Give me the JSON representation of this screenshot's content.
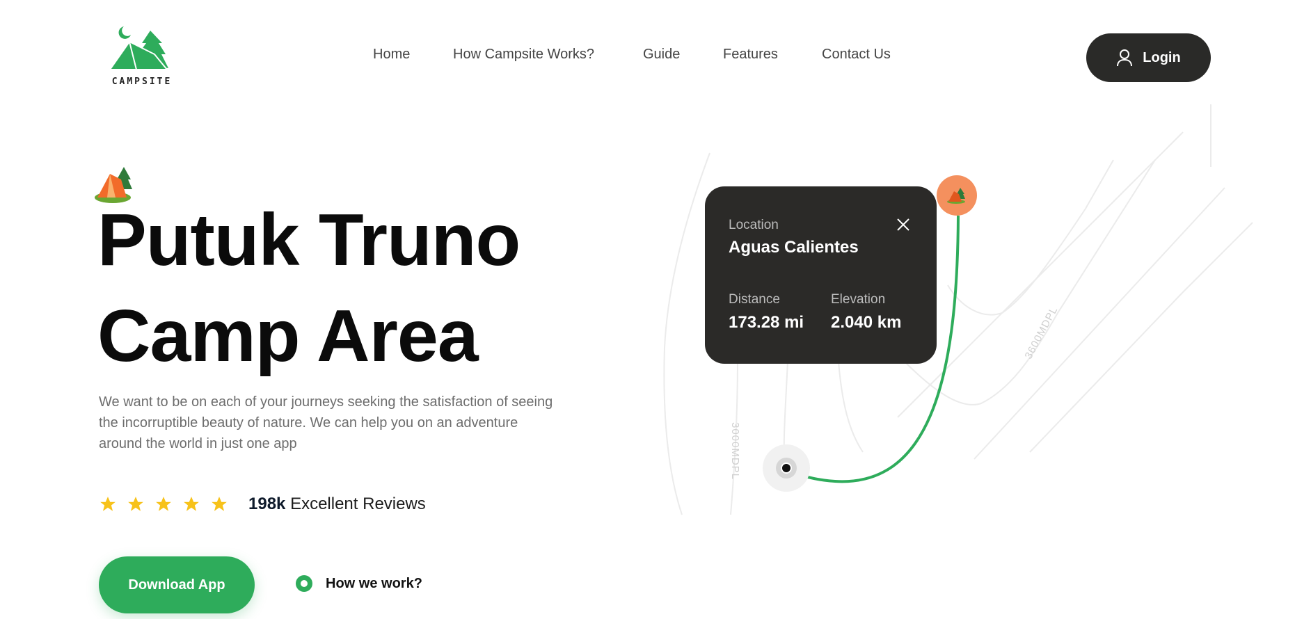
{
  "brand": {
    "name": "CAMPSITE",
    "color": "#2eac5b"
  },
  "nav": {
    "items": [
      "Home",
      "How Campsite Works?",
      "Guide",
      "Features",
      "Contact Us"
    ]
  },
  "login": {
    "label": "Login",
    "icon": "user-icon"
  },
  "hero": {
    "title_line1": "Putuk Truno",
    "title_line2": "Camp Area",
    "description": "We want to be on each of your journeys seeking the satisfaction of seeing the incorruptible beauty of nature. We can help you on an adventure around the world in just one app",
    "rating": 5,
    "reviews_count": "198k",
    "reviews_label": "Excellent Reviews",
    "download_label": "Download App",
    "how_label": "How we work?"
  },
  "map": {
    "card": {
      "location_label": "Location",
      "location": "Aguas Calientes",
      "distance_label": "Distance",
      "distance": "173.28 mi",
      "elevation_label": "Elevation",
      "elevation": "2.040 km"
    },
    "contour_labels": [
      "3600MDPL",
      "3000MDPL"
    ],
    "route_color": "#2eac5b",
    "pin_color": "#f4905e"
  }
}
